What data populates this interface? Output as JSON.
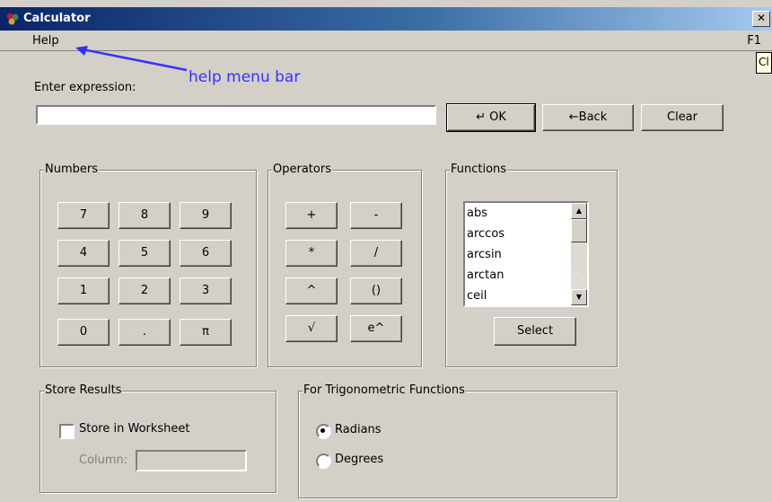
{
  "window": {
    "title": "Calculator",
    "close_glyph": "✕"
  },
  "menu": {
    "help": "Help",
    "f1": "F1"
  },
  "tooltip": {
    "text": "Cl"
  },
  "annotation": {
    "text": "help menu bar"
  },
  "expression": {
    "label": "Enter expression:",
    "value": ""
  },
  "buttons": {
    "ok": "↵ OK",
    "back": "←Back",
    "clear": "Clear",
    "select": "Select"
  },
  "numbers": {
    "label": "Numbers",
    "keys": [
      "7",
      "8",
      "9",
      "4",
      "5",
      "6",
      "1",
      "2",
      "3",
      "0",
      ".",
      "π"
    ]
  },
  "operators": {
    "label": "Operators",
    "keys": [
      "+",
      "-",
      "*",
      "/",
      "^",
      "()",
      "√",
      "e^"
    ]
  },
  "functions": {
    "label": "Functions",
    "items": [
      "abs",
      "arccos",
      "arcsin",
      "arctan",
      "ceil"
    ]
  },
  "store": {
    "label": "Store Results",
    "checkbox_label": "Store in Worksheet",
    "checked": false,
    "column_label": "Column:",
    "column_value": ""
  },
  "trig": {
    "label": "For Trigonometric Functions",
    "radians": "Radians",
    "degrees": "Degrees",
    "selected": "Radians"
  },
  "colors": {
    "annotation": "#3333ff",
    "titlebar_start": "#0a246a",
    "face": "#d4d0c8"
  }
}
